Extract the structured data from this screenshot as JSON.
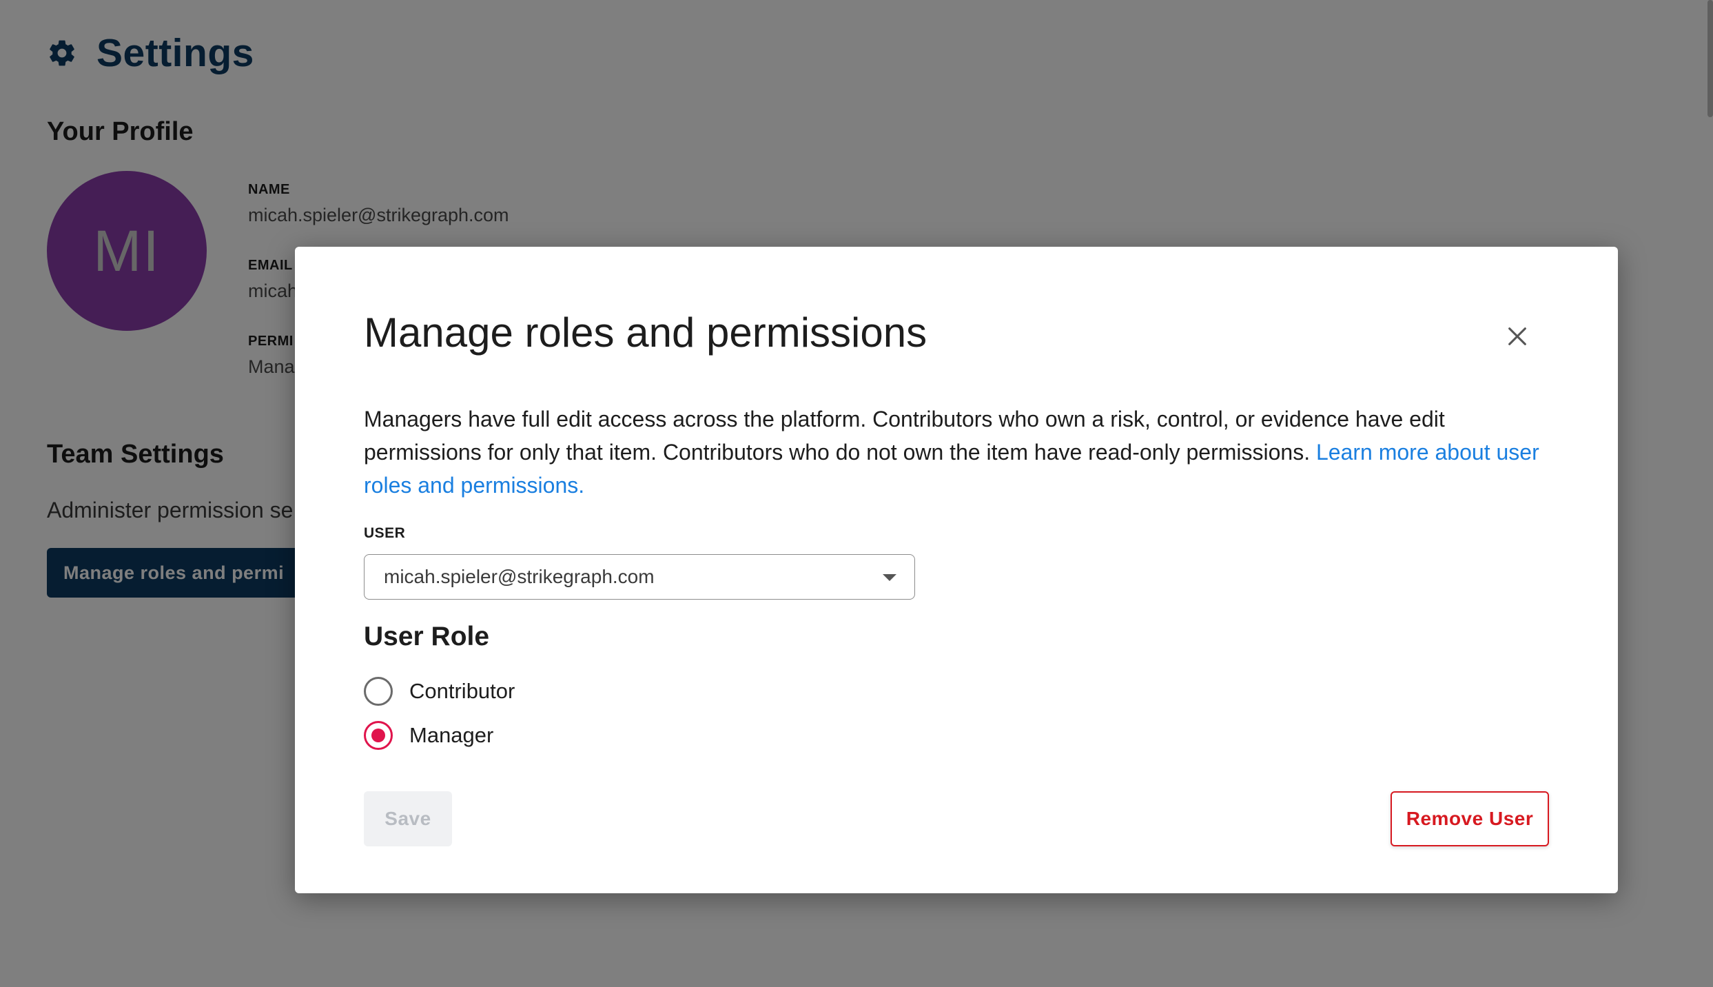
{
  "page": {
    "title": "Settings",
    "gear_icon": "gear-icon"
  },
  "profile": {
    "heading": "Your Profile",
    "avatar_initials": "MI",
    "avatar_color": "#8a3dab",
    "name_label": "NAME",
    "name_value": "micah.spieler@strikegraph.com",
    "email_label": "EMAIL",
    "email_value_visible": "micah",
    "permission_label_visible": "PERMI",
    "permission_value_visible": "Mana"
  },
  "team": {
    "heading": "Team Settings",
    "description_visible": "Administer permission se",
    "manage_button_visible": "Manage roles and permi"
  },
  "modal": {
    "title": "Manage roles and permissions",
    "close_icon": "close-icon",
    "description": "Managers have full edit access across the platform. Contributors who own a risk, control, or evidence have edit permissions for only that item. Contributors who do not own the item have read-only permissions.",
    "learn_more_link": "Learn more about user roles and permissions.",
    "user_field_label": "USER",
    "user_selected": "micah.spieler@strikegraph.com",
    "role_heading": "User Role",
    "roles": [
      {
        "label": "Contributor",
        "checked": false
      },
      {
        "label": "Manager",
        "checked": true
      }
    ],
    "save_label": "Save",
    "remove_label": "Remove User"
  },
  "colors": {
    "brand_navy": "#0c3b63",
    "accent_radio": "#e0144c",
    "danger": "#d71920",
    "link": "#1a7fe0"
  }
}
